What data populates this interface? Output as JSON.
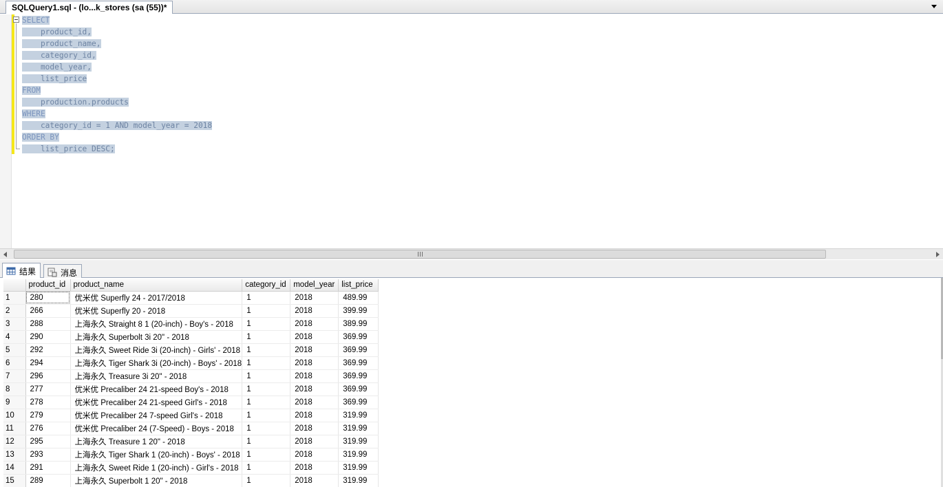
{
  "document_tab": {
    "title": "SQLQuery1.sql - (lo...k_stores (sa (55))*"
  },
  "editor": {
    "lines": [
      "SELECT",
      "    product_id,",
      "    product_name,",
      "    category_id,",
      "    model_year,",
      "    list_price",
      "FROM",
      "    production.products",
      "WHERE",
      "    category_id = 1 AND model_year = 2018",
      "ORDER BY",
      "    list_price DESC;"
    ]
  },
  "results_tabs": [
    {
      "label": "结果",
      "icon": "grid-icon",
      "active": true
    },
    {
      "label": "消息",
      "icon": "messages-icon",
      "active": false
    }
  ],
  "grid": {
    "columns": [
      "product_id",
      "product_name",
      "category_id",
      "model_year",
      "list_price"
    ],
    "rows": [
      [
        "1",
        "280",
        "优米优 Superfly 24 - 2017/2018",
        "1",
        "2018",
        "489.99"
      ],
      [
        "2",
        "266",
        "优米优 Superfly 20 - 2018",
        "1",
        "2018",
        "399.99"
      ],
      [
        "3",
        "288",
        "上海永久 Straight 8 1 (20-inch) - Boy's - 2018",
        "1",
        "2018",
        "389.99"
      ],
      [
        "4",
        "290",
        "上海永久 Superbolt 3i 20\" - 2018",
        "1",
        "2018",
        "369.99"
      ],
      [
        "5",
        "292",
        "上海永久 Sweet Ride 3i (20-inch) - Girls' - 2018",
        "1",
        "2018",
        "369.99"
      ],
      [
        "6",
        "294",
        "上海永久 Tiger Shark 3i (20-inch) - Boys' - 2018",
        "1",
        "2018",
        "369.99"
      ],
      [
        "7",
        "296",
        "上海永久 Treasure 3i 20\" - 2018",
        "1",
        "2018",
        "369.99"
      ],
      [
        "8",
        "277",
        "优米优 Precaliber 24 21-speed Boy's - 2018",
        "1",
        "2018",
        "369.99"
      ],
      [
        "9",
        "278",
        "优米优 Precaliber 24 21-speed Girl's - 2018",
        "1",
        "2018",
        "369.99"
      ],
      [
        "10",
        "279",
        "优米优 Precaliber 24 7-speed Girl's - 2018",
        "1",
        "2018",
        "319.99"
      ],
      [
        "11",
        "276",
        "优米优 Precaliber 24 (7-Speed) - Boys - 2018",
        "1",
        "2018",
        "319.99"
      ],
      [
        "12",
        "295",
        "上海永久 Treasure 1 20\" - 2018",
        "1",
        "2018",
        "319.99"
      ],
      [
        "13",
        "293",
        "上海永久 Tiger Shark 1 (20-inch) - Boys' - 2018",
        "1",
        "2018",
        "319.99"
      ],
      [
        "14",
        "291",
        "上海永久 Sweet Ride 1 (20-inch) - Girl's - 2018",
        "1",
        "2018",
        "319.99"
      ],
      [
        "15",
        "289",
        "上海永久 Superbolt 1 20\" - 2018",
        "1",
        "2018",
        "319.99"
      ]
    ]
  }
}
